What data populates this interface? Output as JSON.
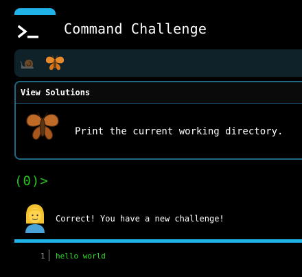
{
  "header": {
    "title": "Command Challenge",
    "icon": "terminal-icon"
  },
  "progress": {
    "icons": [
      "snail-icon",
      "moth-icon"
    ]
  },
  "challenge": {
    "view_solutions": "View Solutions",
    "icon": "moth-icon",
    "text": "Print the current working directory."
  },
  "terminal": {
    "prompt": "(0)>"
  },
  "feedback": {
    "avatar": "woman-avatar",
    "message": "Correct! You have a new challenge!"
  },
  "editor": {
    "line_number": "1",
    "code": "hello world"
  },
  "colors": {
    "accent": "#1fb3e8",
    "prompt": "#22c41b",
    "code": "#2ee02a",
    "border": "#1e6a86"
  }
}
